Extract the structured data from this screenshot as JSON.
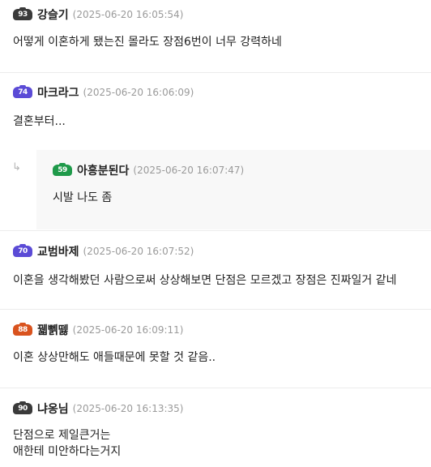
{
  "comments": [
    {
      "badge": "93",
      "badge_color": "#3a3a3a",
      "author": "강슬기",
      "date": "(2025-06-20 16:05:54)",
      "lines": [
        "어떻게 이혼하게 됐는진 몰라도 장점6번이 너무 강력하네"
      ]
    },
    {
      "badge": "74",
      "badge_color": "#5b4bd6",
      "author": "마크라그",
      "date": "(2025-06-20 16:06:09)",
      "lines": [
        "결혼부터..."
      ]
    },
    {
      "badge": "70",
      "badge_color": "#5b4bd6",
      "author": "교범바제",
      "date": "(2025-06-20 16:07:52)",
      "lines": [
        "이혼을 생각해봤던 사람으로써 상상해보면 단점은 모르겠고 장점은 진짜일거 같네"
      ]
    },
    {
      "badge": "88",
      "badge_color": "#d9531e",
      "author": "꿻뻵뗋",
      "date": "(2025-06-20 16:09:11)",
      "lines": [
        "이혼 상상만해도 애들때문에 못할 것 같음.."
      ]
    },
    {
      "badge": "90",
      "badge_color": "#3a3a3a",
      "author": "냐옹님",
      "date": "(2025-06-20 16:13:35)",
      "lines": [
        "단점으로 제일큰거는",
        "애한테 미안하다는거지"
      ]
    }
  ],
  "reply": {
    "arrow": "↳",
    "badge": "59",
    "badge_color": "#1f9a4a",
    "author": "아흥분된다",
    "date": "(2025-06-20 16:07:47)",
    "lines": [
      "시발 나도 좀"
    ]
  }
}
